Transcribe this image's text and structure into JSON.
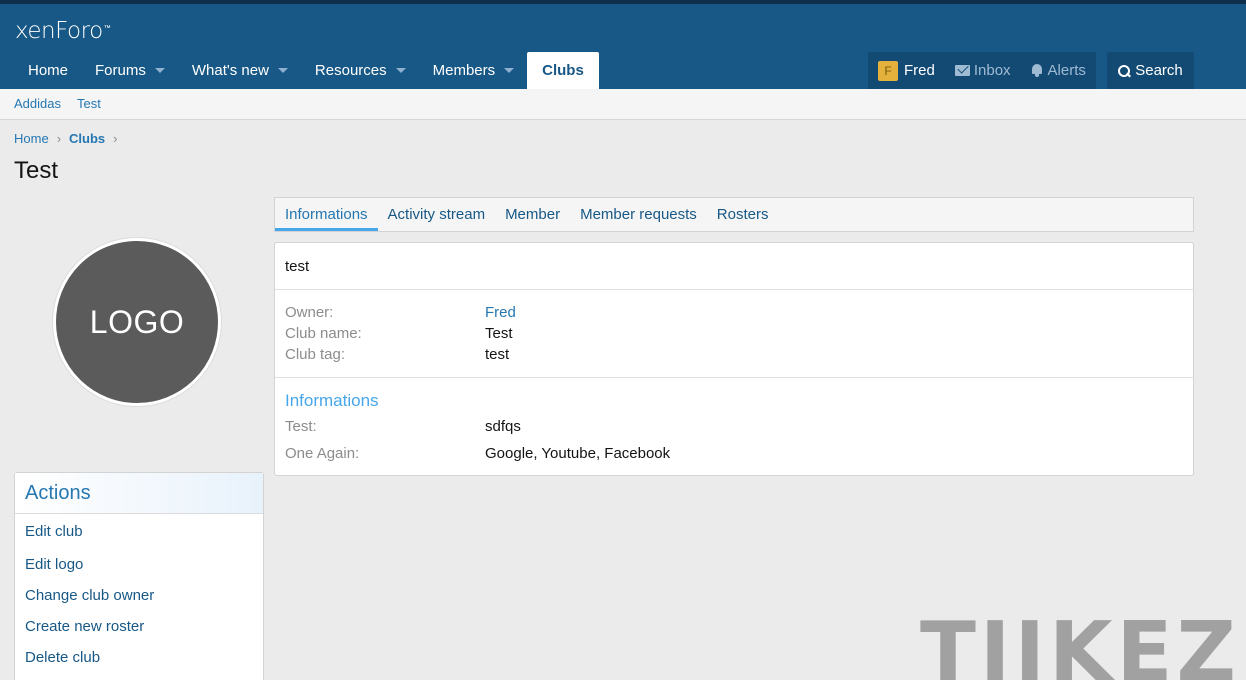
{
  "brand": {
    "name": "xenForo",
    "tm": "™"
  },
  "nav": {
    "tabs": [
      {
        "label": "Home"
      },
      {
        "label": "Forums"
      },
      {
        "label": "What's new"
      },
      {
        "label": "Resources"
      },
      {
        "label": "Members"
      },
      {
        "label": "Clubs"
      }
    ],
    "active": "Clubs"
  },
  "usernav": {
    "avatar_letter": "F",
    "username": "Fred",
    "inbox_label": "Inbox",
    "alerts_label": "Alerts",
    "search_label": "Search"
  },
  "subnav": {
    "items": [
      {
        "label": "Addidas"
      },
      {
        "label": "Test"
      }
    ]
  },
  "breadcrumb": {
    "items": [
      {
        "label": "Home"
      },
      {
        "label": "Clubs"
      }
    ]
  },
  "page": {
    "title": "Test"
  },
  "club_logo": {
    "text": "LOGO"
  },
  "actions": {
    "title": "Actions",
    "items": [
      {
        "label": "Edit club"
      },
      {
        "label": "Edit logo"
      },
      {
        "label": "Change club owner"
      },
      {
        "label": "Create new roster"
      },
      {
        "label": "Delete club"
      }
    ]
  },
  "tabs": {
    "items": [
      {
        "label": "Informations"
      },
      {
        "label": "Activity stream"
      },
      {
        "label": "Member"
      },
      {
        "label": "Member requests"
      },
      {
        "label": "Rosters"
      }
    ],
    "active": "Informations"
  },
  "details": {
    "description": "test",
    "owner_label": "Owner:",
    "owner_value": "Fred",
    "club_name_label": "Club name:",
    "club_name_value": "Test",
    "club_tag_label": "Club tag:",
    "club_tag_value": "test",
    "section_title": "Informations",
    "fields": [
      {
        "label": "Test:",
        "value": "sdfqs"
      },
      {
        "label": "One Again:",
        "value": "Google, Youtube, Facebook"
      }
    ]
  },
  "watermark": {
    "text": "TIIKEZ"
  },
  "colors": {
    "header": "#185886",
    "header_dark": "#134a74",
    "link": "#2577b1",
    "accent": "#47a7eb",
    "avatar": "#e3b13c",
    "logo_circle": "#5b5b5b"
  }
}
